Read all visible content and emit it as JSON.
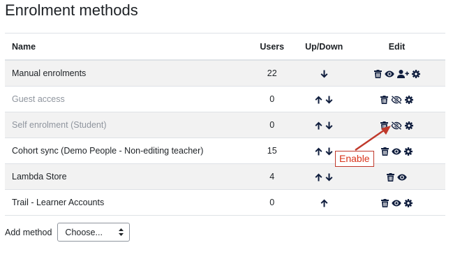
{
  "page": {
    "title": "Enrolment methods"
  },
  "table": {
    "headers": {
      "name": "Name",
      "users": "Users",
      "updown": "Up/Down",
      "edit": "Edit"
    },
    "rows": [
      {
        "name": "Manual enrolments",
        "users": "22",
        "enabled": true,
        "up": false,
        "down": true,
        "edit_icons": [
          "trash-icon",
          "eye-icon",
          "user-plus-icon",
          "gear-icon"
        ]
      },
      {
        "name": "Guest access",
        "users": "0",
        "enabled": false,
        "up": true,
        "down": true,
        "edit_icons": [
          "trash-icon",
          "eye-slash-icon",
          "gear-icon"
        ]
      },
      {
        "name": "Self enrolment (Student)",
        "users": "0",
        "enabled": false,
        "up": true,
        "down": true,
        "edit_icons": [
          "trash-icon",
          "eye-slash-icon",
          "gear-icon"
        ]
      },
      {
        "name": "Cohort sync (Demo People - Non-editing teacher)",
        "users": "15",
        "enabled": true,
        "up": true,
        "down": true,
        "edit_icons": [
          "trash-icon",
          "eye-icon",
          "gear-icon"
        ]
      },
      {
        "name": "Lambda Store",
        "users": "4",
        "enabled": true,
        "up": true,
        "down": true,
        "edit_icons": [
          "trash-icon",
          "eye-icon"
        ]
      },
      {
        "name": "Trail - Learner Accounts",
        "users": "0",
        "enabled": true,
        "up": true,
        "down": false,
        "edit_icons": [
          "trash-icon",
          "eye-icon",
          "gear-icon"
        ]
      }
    ]
  },
  "add_method": {
    "label": "Add method",
    "selected": "Choose..."
  },
  "annotation": {
    "text": "Enable",
    "color": "#d9341b"
  },
  "colors": {
    "icon": "#0f1d3d",
    "dimmed_text": "#8f959e",
    "stripe": "#f2f2f2"
  }
}
